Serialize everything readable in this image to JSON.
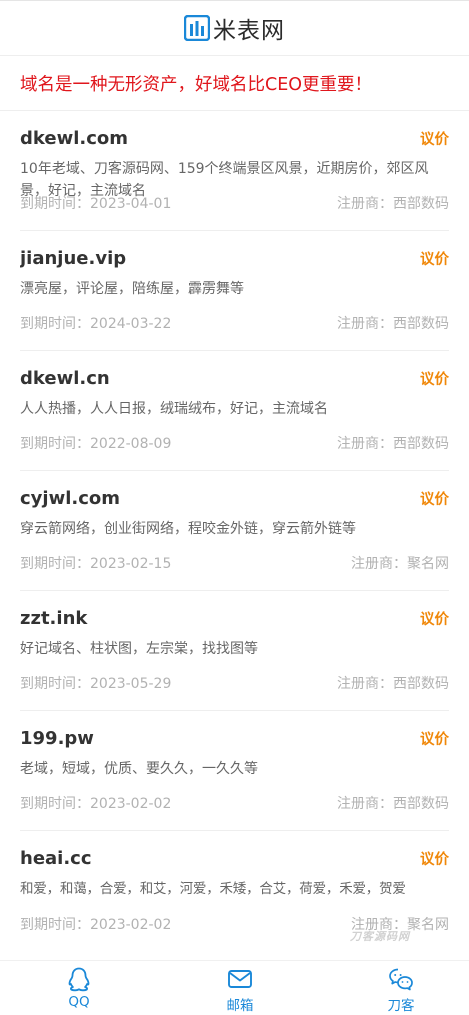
{
  "header": {
    "logo_text": "米表网"
  },
  "slogan": "域名是一种无形资产，好域名比CEO更重要！",
  "colors": {
    "brand": "#1a88d8",
    "slogan": "#e0161c",
    "offer": "#f0880a"
  },
  "domains": [
    {
      "name": "dkewl.com",
      "offer": "议价",
      "desc": "10年老域、刀客源码网、159个终端景区风景，近期房价，郊区风景，好记，主流域名",
      "expiry": "到期时间：2023-04-01",
      "registrar": "注册商：西部数码"
    },
    {
      "name": "jianjue.vip",
      "offer": "议价",
      "desc": "漂亮屋，评论屋，陪练屋，霹雳舞等",
      "expiry": "到期时间：2024-03-22",
      "registrar": "注册商：西部数码"
    },
    {
      "name": "dkewl.cn",
      "offer": "议价",
      "desc": "人人热播，人人日报，绒瑞绒布，好记，主流域名",
      "expiry": "到期时间：2022-08-09",
      "registrar": "注册商：西部数码"
    },
    {
      "name": "cyjwl.com",
      "offer": "议价",
      "desc": "穿云箭网络，创业街网络，程咬金外链，穿云箭外链等",
      "expiry": "到期时间：2023-02-15",
      "registrar": "注册商：聚名网"
    },
    {
      "name": "zzt.ink",
      "offer": "议价",
      "desc": "好记域名、柱状图，左宗棠，找找图等",
      "expiry": "到期时间：2023-05-29",
      "registrar": "注册商：西部数码"
    },
    {
      "name": "199.pw",
      "offer": "议价",
      "desc": "老域，短域，优质、要久久，一久久等",
      "expiry": "到期时间：2023-02-02",
      "registrar": "注册商：西部数码"
    },
    {
      "name": "heai.cc",
      "offer": "议价",
      "desc": "和爱，和蔼，合爱，和艾，河爱，禾矮，合艾，荷爱，禾爱，贺爱",
      "expiry": "到期时间：2023-02-02",
      "registrar": "注册商：聚名网"
    }
  ],
  "watermark": "刀客源码网",
  "bottom_nav": [
    {
      "label": "QQ",
      "icon": "qq-icon"
    },
    {
      "label": "邮箱",
      "icon": "mail-icon"
    },
    {
      "label": "刀客",
      "icon": "wechat-icon"
    }
  ]
}
